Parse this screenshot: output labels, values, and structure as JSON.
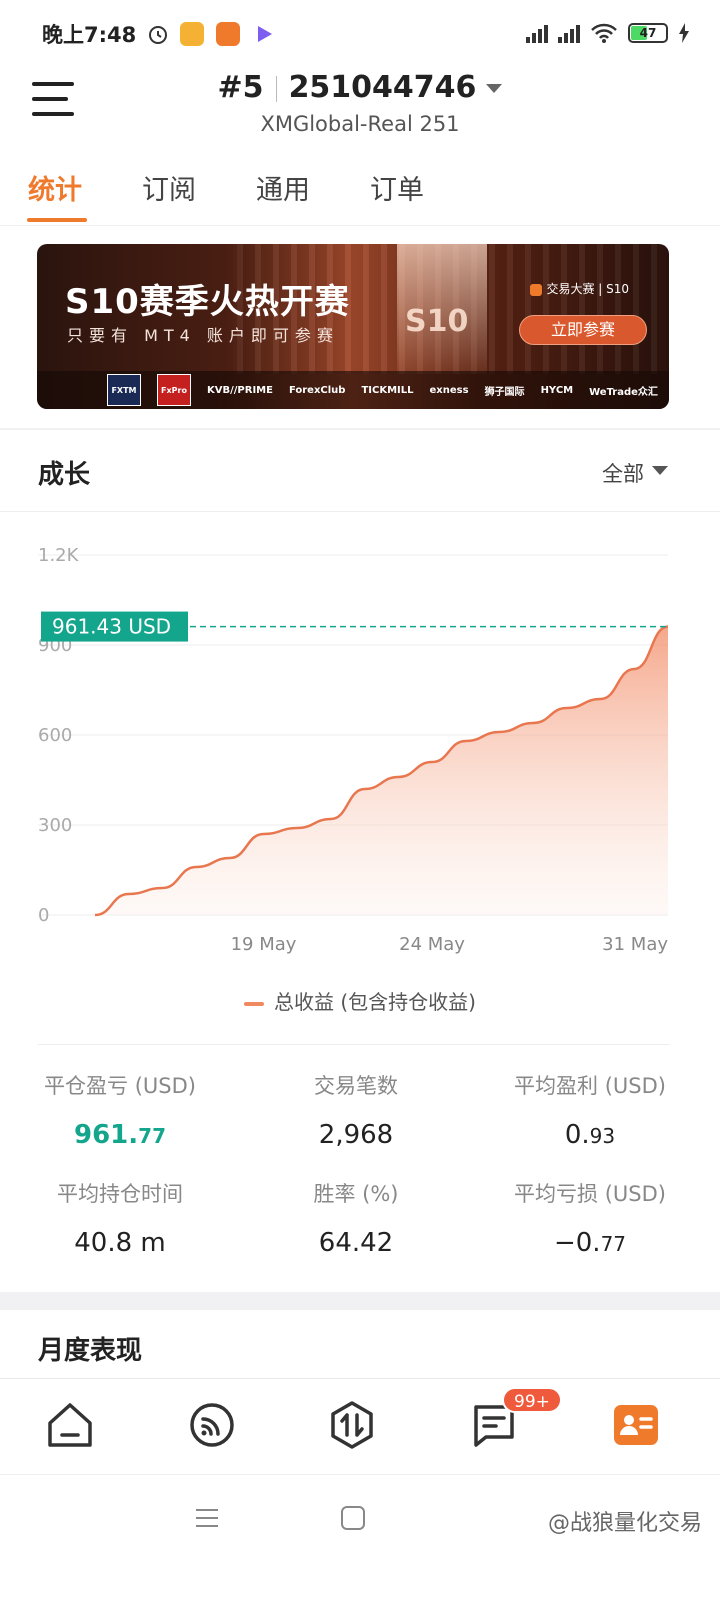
{
  "status_bar": {
    "time": "晚上7:48",
    "battery": "47"
  },
  "header": {
    "account_index": "#5",
    "account_number": "251044746",
    "server": "XMGlobal-Real 251"
  },
  "tabs": [
    {
      "label": "统计",
      "active": true
    },
    {
      "label": "订阅",
      "active": false
    },
    {
      "label": "通用",
      "active": false
    },
    {
      "label": "订单",
      "active": false
    }
  ],
  "banner": {
    "title": "S10赛季火热开赛",
    "subtitle": "只要有 MT4 账户即可参赛",
    "center_mark": "S10",
    "brand": "交易大赛 | S10",
    "cta": "立即参赛",
    "sponsors": [
      "FXTM",
      "FxPro",
      "KVB//PRIME",
      "ForexClub",
      "TICKMILL",
      "exness",
      "狮子国际",
      "HYCM",
      "WeTrade众汇"
    ]
  },
  "growth": {
    "title": "成长",
    "range": "全部",
    "legend": "总收益 (包含持仓收益)"
  },
  "chart_data": {
    "type": "area",
    "x": [
      "14 May",
      "15 May",
      "16 May",
      "17 May",
      "18 May",
      "19 May",
      "20 May",
      "21 May",
      "22 May",
      "23 May",
      "24 May",
      "25 May",
      "26 May",
      "27 May",
      "28 May",
      "29 May",
      "30 May",
      "31 May"
    ],
    "y_curve": [
      0,
      70,
      90,
      160,
      190,
      270,
      290,
      320,
      420,
      460,
      510,
      580,
      610,
      640,
      690,
      720,
      820,
      961.43
    ],
    "x_tick_labels": [
      "19 May",
      "24 May",
      "31 May"
    ],
    "y_ticks": [
      0,
      300,
      600,
      900,
      1200
    ],
    "y_tick_labels": [
      "0",
      "300",
      "600",
      "900",
      "1.2K"
    ],
    "ylim": [
      0,
      1200
    ],
    "current_value_label": "961.43 USD",
    "current_value": 961.43,
    "series": [
      {
        "name": "总收益 (包含持仓收益)",
        "color": "#f08860"
      }
    ],
    "legend_position": "bottom",
    "grid": true
  },
  "stats": [
    {
      "label": "平仓盈亏 (USD)",
      "int": "961.",
      "dec": "77",
      "green": true
    },
    {
      "label": "交易笔数",
      "int": "2,968",
      "dec": "",
      "green": false
    },
    {
      "label": "平均盈利 (USD)",
      "int": "0.",
      "dec": "93",
      "green": false
    },
    {
      "label": "平均持仓时间",
      "int": "40.8 m",
      "dec": "",
      "green": false
    },
    {
      "label": "胜率 (%)",
      "int": "64.42",
      "dec": "",
      "green": false
    },
    {
      "label": "平均亏损 (USD)",
      "int": "−0.",
      "dec": "77",
      "green": false
    }
  ],
  "monthly": {
    "title": "月度表现"
  },
  "bottom_nav": {
    "items": [
      "home-icon",
      "feed-icon",
      "trade-icon",
      "messages-icon",
      "profile-icon"
    ],
    "badge": "99+"
  },
  "watermark": "@战狼量化交易",
  "colors": {
    "accent": "#f07a2c",
    "green": "#14a58d",
    "area": "#f08860"
  }
}
